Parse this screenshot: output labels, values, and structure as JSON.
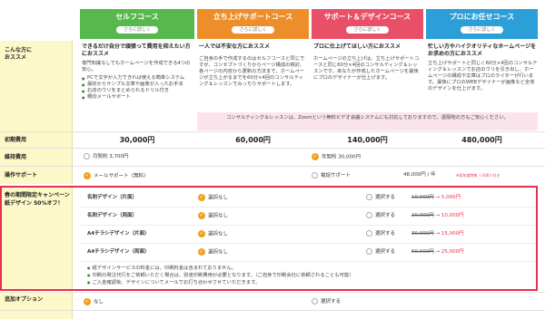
{
  "courses": [
    {
      "title": "セルフコース",
      "btn": "さらに詳しく",
      "color": "#56b84d"
    },
    {
      "title": "立ち上げサポートコース",
      "btn": "さらに詳しく",
      "color": "#ee8e2a"
    },
    {
      "title": "サポート＆デザインコース",
      "btn": "さらに詳しく",
      "color": "#ea4f68"
    },
    {
      "title": "プロにお任せコース",
      "btn": "さらに詳しく",
      "color": "#2d9fd8"
    }
  ],
  "labels": {
    "recommend": "こんな方に\nおススメ",
    "initial": "初期費用",
    "maintenance": "維持費用",
    "support": "操作サポート",
    "campaign": "春の期間限定キャンペーン\n紙デザイン 50%オフ！",
    "option": "追加オプション"
  },
  "recommend": [
    {
      "heading": "できるだけ自分で頑張って費用を抑えたい方におススメ",
      "body": "専門知識なしでもホームページを作成できる4つの安心。",
      "items": [
        "PCで文字が入力できれば使える簡単システム",
        "最初からサンプル文章や画像が入ったお手本",
        "お店のウリをまとめられるドリル付き",
        "親切メールサポート"
      ]
    },
    {
      "heading": "一人では不安な方におススメ",
      "body": "ご自身の手で作成するのはセルフコースと同じですが、コンセプトづくりからページ構成の検討、各ページの内容から更新の方法まで、ホームページが立ち上がるまでを60分×4回のコンサルティング＆レッスンでみっちりサポートします。"
    },
    {
      "heading": "プロに仕上げてほしい方におススメ",
      "body": "ホームページの立ち上げは、立ち上げサポートコースと同じ60分×4回のコンサルティング＆レッスンです。あなたが作成したホームページを最後にプロのデザイナーが仕上げます。"
    },
    {
      "heading": "忙しい方やハイクオリティなホームページをお求めの方におススメ",
      "body": "立ち上げサポートと同じく60分×4回のコンサルティング＆レッスンでお店のウリを引き出し、ホームページの構成や文章はプロのライターが行います。最後にプロのWEBデザイナーが画像など全体のデザインを仕上げます。"
    }
  ],
  "zoom_note": "コンサルティング＆レッスンは、Zoomという無料ビデオ会議システムにも対応しておりますので、遠隔地の方もご安心ください。",
  "prices": [
    "30,000円",
    "60,000円",
    "140,000円",
    "480,000円"
  ],
  "maintenance": {
    "left": "月契約 3,700円",
    "right": "年契約 30,000円"
  },
  "support": {
    "left": "メールサポート（無料）",
    "right": "電話サポート",
    "right_price": "48,000円 / 年",
    "right_note": "※初年度特典（-200人付き"
  },
  "campaign_rows": [
    {
      "name": "名刺デザイン（片面）",
      "none": "選択なし",
      "select": "選択する",
      "old": "10,000円",
      "new": "5,000円"
    },
    {
      "name": "名刺デザイン（両面）",
      "none": "選択なし",
      "select": "選択する",
      "old": "20,000円",
      "new": "10,000円"
    },
    {
      "name": "A4チラシデザイン（片面）",
      "none": "選択なし",
      "select": "選択する",
      "old": "30,000円",
      "new": "15,000円"
    },
    {
      "name": "A4チラシデザイン（両面）",
      "none": "選択なし",
      "select": "選択する",
      "old": "50,000円",
      "new": "25,000円"
    }
  ],
  "arrow": "→",
  "notes": [
    "紙デザインサービスの料金には、印刷料金は含まれておりません。",
    "印刷の発注代行をご依頼いただく場合は、別途印刷費用が必要となります。（ご自身で印刷会社に依頼されることも可能）",
    "ご入金確認後、デザインについてメールでお打ち合わせさせていただきます。"
  ],
  "option": {
    "left": "なし",
    "right": "選択する"
  }
}
